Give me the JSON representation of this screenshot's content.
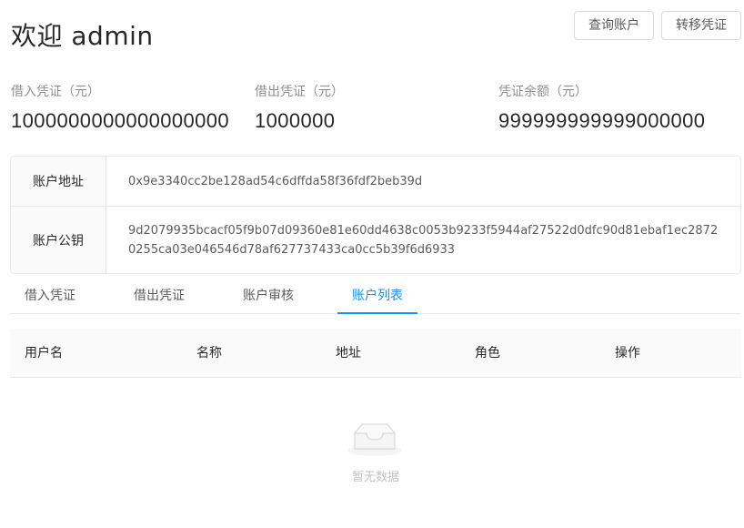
{
  "header": {
    "welcome": "欢迎 admin",
    "query_button": "查询账户",
    "transfer_button": "转移凭证"
  },
  "stats": [
    {
      "label": "借入凭证（元）",
      "value": "1000000000000000000"
    },
    {
      "label": "借出凭证（元）",
      "value": "1000000"
    },
    {
      "label": "凭证余额（元）",
      "value": "999999999999000000"
    }
  ],
  "account": {
    "address_label": "账户地址",
    "address": "0x9e3340cc2be128ad54c6dffda58f36fdf2beb39d",
    "pubkey_label": "账户公钥",
    "pubkey": "9d2079935bcacf05f9b07d09360e81e60dd4638c0053b9233f5944af27522d0dfc90d81ebaf1ec28720255ca03e046546d78af627737433ca0cc5b39f6d6933"
  },
  "tabs": [
    "借入凭证",
    "借出凭证",
    "账户审核",
    "账户列表"
  ],
  "active_tab_index": 3,
  "table": {
    "columns": [
      "用户名",
      "名称",
      "地址",
      "角色",
      "操作"
    ],
    "rows": [],
    "empty_text": "暂无数据"
  },
  "colors": {
    "accent": "#1890ff",
    "border": "#e8e8e8",
    "header_bg": "#fafafa"
  }
}
